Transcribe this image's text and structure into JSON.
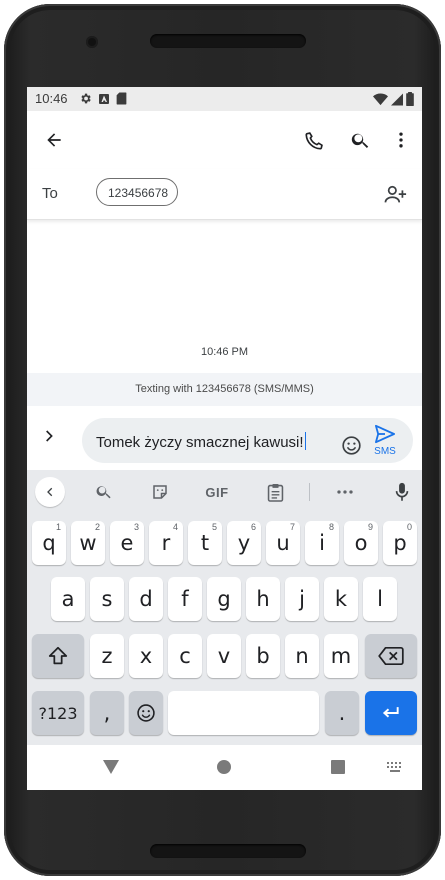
{
  "status_bar": {
    "time": "10:46",
    "icons": [
      "settings-icon",
      "a-badge-icon",
      "sd-card-icon",
      "wifi-icon",
      "signal-icon",
      "battery-icon"
    ]
  },
  "app_bar": {
    "actions": [
      "back-arrow-icon",
      "phone-icon",
      "search-icon",
      "more-vert-icon"
    ]
  },
  "recipient": {
    "label": "To",
    "chip": "123456678"
  },
  "conversation": {
    "timestamp": "10:46 PM",
    "info": "Texting with 123456678 (SMS/MMS)"
  },
  "composer": {
    "text": "Tomek życzy smacznej kawusi!",
    "send_label": "SMS"
  },
  "keyboard": {
    "toolbar": [
      "back-icon",
      "search-icon",
      "sticker-icon",
      "GIF",
      "clipboard-icon",
      "more-icon",
      "mic-icon"
    ],
    "gif_label": "GIF",
    "row1": [
      {
        "k": "q",
        "h": "1"
      },
      {
        "k": "w",
        "h": "2"
      },
      {
        "k": "e",
        "h": "3"
      },
      {
        "k": "r",
        "h": "4"
      },
      {
        "k": "t",
        "h": "5"
      },
      {
        "k": "y",
        "h": "6"
      },
      {
        "k": "u",
        "h": "7"
      },
      {
        "k": "i",
        "h": "8"
      },
      {
        "k": "o",
        "h": "9"
      },
      {
        "k": "p",
        "h": "0"
      }
    ],
    "row2": [
      "a",
      "s",
      "d",
      "f",
      "g",
      "h",
      "j",
      "k",
      "l"
    ],
    "row3": [
      "z",
      "x",
      "c",
      "v",
      "b",
      "n",
      "m"
    ],
    "sym_label": "?123",
    "comma_label": ",",
    "period_label": "."
  },
  "colors": {
    "accent": "#1a73e8",
    "input_bg": "#eceff1",
    "keyboard_bg": "#e8eaed"
  }
}
